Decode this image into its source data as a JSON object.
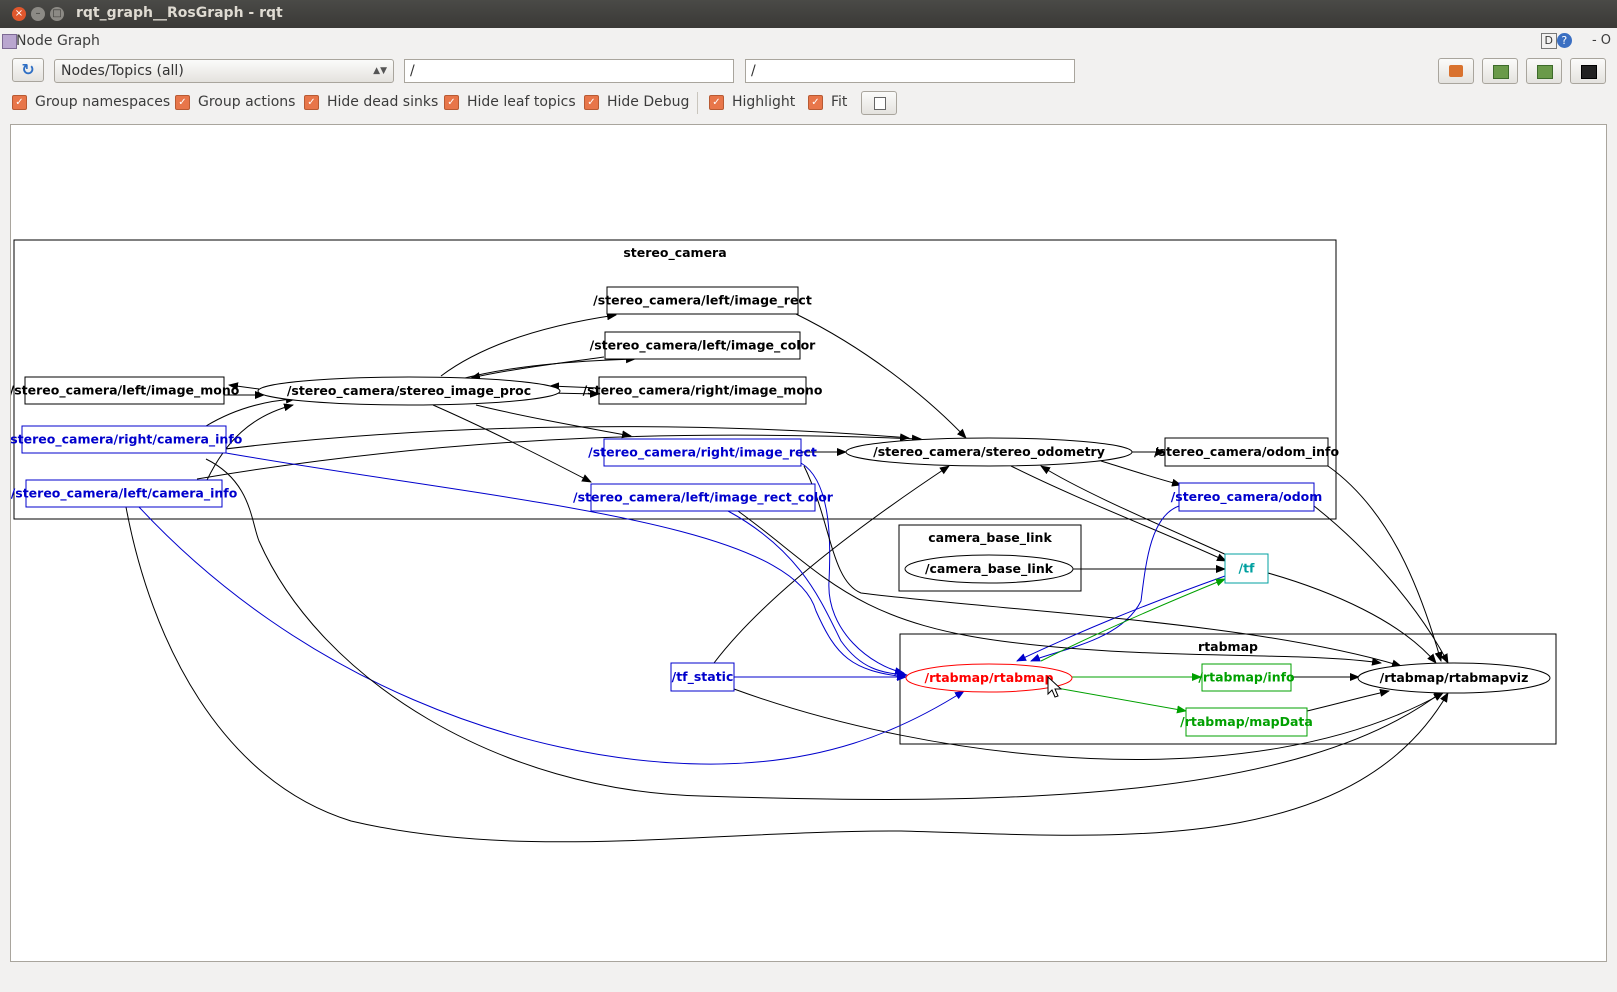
{
  "window": {
    "title": "rqt_graph__RosGraph - rqt",
    "close_glyph": "×",
    "min_glyph": "–",
    "max_glyph": "□"
  },
  "plugin": {
    "title": "Node Graph",
    "help_d": "D",
    "help_q": "?",
    "right_text": "- O"
  },
  "toolbar": {
    "refresh_glyph": "↻",
    "mode_select": "Nodes/Topics (all)",
    "mode_arrow": "▲▼",
    "filter_include": "/",
    "filter_exclude": "/",
    "icons": [
      "open-file-icon",
      "save-dot-icon",
      "save-svg-icon",
      "screenshot-icon"
    ]
  },
  "options": [
    {
      "label": "Group namespaces",
      "checked": true
    },
    {
      "label": "Group actions",
      "checked": true
    },
    {
      "label": "Hide dead sinks",
      "checked": true
    },
    {
      "label": "Hide leaf topics",
      "checked": true
    },
    {
      "label": "Hide Debug",
      "checked": true
    },
    {
      "label": "Highlight",
      "checked": true
    },
    {
      "label": "Fit",
      "checked": true
    }
  ],
  "check_glyph": "✓",
  "graph": {
    "colors": {
      "black": "#000000",
      "blue": "#0000cc",
      "red": "#ff0000",
      "green": "#00a000",
      "cyan": "#00a0a0"
    },
    "clusters": [
      {
        "id": "c1",
        "label": "stereo_camera"
      },
      {
        "id": "c2",
        "label": "camera_base_link"
      },
      {
        "id": "c3",
        "label": "rtabmap"
      }
    ],
    "nodes": [
      {
        "id": "n1",
        "label": "/stereo_camera/left/image_mono",
        "shape": "box",
        "color": "black"
      },
      {
        "id": "n2",
        "label": "/stereo_camera/stereo_image_proc",
        "shape": "ellipse",
        "color": "black"
      },
      {
        "id": "n3",
        "label": "/stereo_camera/left/image_rect",
        "shape": "box",
        "color": "black"
      },
      {
        "id": "n4",
        "label": "/stereo_camera/left/image_color",
        "shape": "box",
        "color": "black"
      },
      {
        "id": "n5",
        "label": "/stereo_camera/right/image_mono",
        "shape": "box",
        "color": "black"
      },
      {
        "id": "n6",
        "label": "/stereo_camera/right/camera_info",
        "shape": "box",
        "color": "blue"
      },
      {
        "id": "n7",
        "label": "/stereo_camera/left/camera_info",
        "shape": "box",
        "color": "blue"
      },
      {
        "id": "n8",
        "label": "/stereo_camera/right/image_rect",
        "shape": "box",
        "color": "blue"
      },
      {
        "id": "n9",
        "label": "/stereo_camera/left/image_rect_color",
        "shape": "box",
        "color": "blue"
      },
      {
        "id": "n10",
        "label": "/stereo_camera/stereo_odometry",
        "shape": "ellipse",
        "color": "black"
      },
      {
        "id": "n11",
        "label": "/stereo_camera/odom_info",
        "shape": "box",
        "color": "black"
      },
      {
        "id": "n12",
        "label": "/stereo_camera/odom",
        "shape": "box",
        "color": "blue"
      },
      {
        "id": "n13",
        "label": "/camera_base_link",
        "shape": "ellipse",
        "color": "black"
      },
      {
        "id": "n14",
        "label": "/tf",
        "shape": "box",
        "color": "cyan"
      },
      {
        "id": "n15",
        "label": "/tf_static",
        "shape": "box",
        "color": "blue"
      },
      {
        "id": "n16",
        "label": "/rtabmap/rtabmap",
        "shape": "ellipse",
        "color": "red"
      },
      {
        "id": "n17",
        "label": "/rtabmap/info",
        "shape": "box",
        "color": "green"
      },
      {
        "id": "n18",
        "label": "/rtabmap/mapData",
        "shape": "box",
        "color": "green"
      },
      {
        "id": "n19",
        "label": "/rtabmap/rtabmapviz",
        "shape": "ellipse",
        "color": "black"
      }
    ],
    "edges": [
      {
        "from": "n2",
        "to": "n1",
        "color": "black"
      },
      {
        "from": "n1",
        "to": "n2",
        "color": "black"
      },
      {
        "from": "n2",
        "to": "n3",
        "color": "black"
      },
      {
        "from": "n2",
        "to": "n4",
        "color": "black"
      },
      {
        "from": "n4",
        "to": "n2",
        "color": "black"
      },
      {
        "from": "n2",
        "to": "n5",
        "color": "black"
      },
      {
        "from": "n5",
        "to": "n2",
        "color": "black"
      },
      {
        "from": "n6",
        "to": "n2",
        "color": "black"
      },
      {
        "from": "n7",
        "to": "n2",
        "color": "black"
      },
      {
        "from": "n2",
        "to": "n8",
        "color": "black"
      },
      {
        "from": "n2",
        "to": "n9",
        "color": "black"
      },
      {
        "from": "n8",
        "to": "n10",
        "color": "black"
      },
      {
        "from": "n3",
        "to": "n10",
        "color": "black"
      },
      {
        "from": "n6",
        "to": "n10",
        "color": "black"
      },
      {
        "from": "n7",
        "to": "n10",
        "color": "black"
      },
      {
        "from": "n10",
        "to": "n11",
        "color": "black"
      },
      {
        "from": "n10",
        "to": "n12",
        "color": "black"
      },
      {
        "from": "n10",
        "to": "n14",
        "color": "black"
      },
      {
        "from": "n14",
        "to": "n10",
        "color": "black"
      },
      {
        "from": "n13",
        "to": "n14",
        "color": "black"
      },
      {
        "from": "n15",
        "to": "n10",
        "color": "black"
      },
      {
        "from": "n15",
        "to": "n16",
        "color": "blue"
      },
      {
        "from": "n15",
        "to": "n19",
        "color": "black"
      },
      {
        "from": "n8",
        "to": "n16",
        "color": "blue"
      },
      {
        "from": "n9",
        "to": "n16",
        "color": "blue"
      },
      {
        "from": "n6",
        "to": "n16",
        "color": "blue"
      },
      {
        "from": "n7",
        "to": "n16",
        "color": "blue"
      },
      {
        "from": "n12",
        "to": "n16",
        "color": "blue"
      },
      {
        "from": "n14",
        "to": "n16",
        "color": "blue"
      },
      {
        "from": "n16",
        "to": "n14",
        "color": "green"
      },
      {
        "from": "n16",
        "to": "n17",
        "color": "green"
      },
      {
        "from": "n16",
        "to": "n18",
        "color": "green"
      },
      {
        "from": "n17",
        "to": "n19",
        "color": "black"
      },
      {
        "from": "n18",
        "to": "n19",
        "color": "black"
      },
      {
        "from": "n11",
        "to": "n19",
        "color": "black"
      },
      {
        "from": "n12",
        "to": "n19",
        "color": "black"
      },
      {
        "from": "n14",
        "to": "n19",
        "color": "black"
      },
      {
        "from": "n9",
        "to": "n19",
        "color": "black"
      },
      {
        "from": "n8",
        "to": "n19",
        "color": "black"
      },
      {
        "from": "n6",
        "to": "n19",
        "color": "black"
      },
      {
        "from": "n7",
        "to": "n19",
        "color": "black"
      }
    ]
  }
}
